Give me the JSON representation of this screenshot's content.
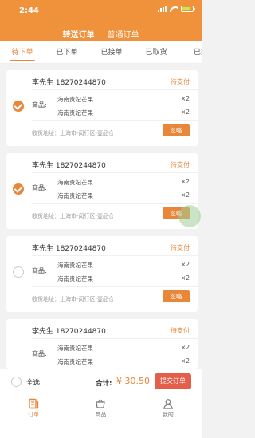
{
  "status_bar": {
    "time": "2:44"
  },
  "order_type_tabs": [
    {
      "label": "转送订单",
      "active": true
    },
    {
      "label": "普通订单",
      "active": false
    }
  ],
  "status_tabs": [
    {
      "label": "待下单",
      "active": true
    },
    {
      "label": "已下单",
      "active": false
    },
    {
      "label": "已接单",
      "active": false
    },
    {
      "label": "已取货",
      "active": false
    },
    {
      "label": "已完",
      "active": false
    }
  ],
  "orders": [
    {
      "name": "李先生 18270244870",
      "status": "待支付",
      "goods_label": "商品:",
      "items": [
        {
          "name": "海南贵妃芒果",
          "qty": "×2"
        },
        {
          "name": "海南贵妃芒果",
          "qty": "×2"
        }
      ],
      "address": "收货地址：上海市-闵行区-壹品仓",
      "ignore_label": "忽略",
      "checked": true
    },
    {
      "name": "李先生 18270244870",
      "status": "待支付",
      "goods_label": "商品:",
      "items": [
        {
          "name": "海南贵妃芒果",
          "qty": "×2"
        },
        {
          "name": "海南贵妃芒果",
          "qty": "×2"
        }
      ],
      "address": "收货地址：上海市-闵行区-壹品仓",
      "ignore_label": "忽略",
      "checked": true
    },
    {
      "name": "李先生 18270244870",
      "status": "待支付",
      "goods_label": "商品:",
      "items": [
        {
          "name": "海南贵妃芒果",
          "qty": "×2"
        },
        {
          "name": "海南贵妃芒果",
          "qty": "×2"
        }
      ],
      "address": "收货地址：上海市-闵行区-壹品仓",
      "ignore_label": "忽略",
      "checked": false
    },
    {
      "name": "李先生 18270244870",
      "status": "待支付",
      "goods_label": "商品:",
      "items": [
        {
          "name": "海南贵妃芒果",
          "qty": "×2"
        },
        {
          "name": "海南贵妃芒果",
          "qty": "×2"
        }
      ],
      "address": "",
      "ignore_label": "",
      "checked": false
    }
  ],
  "footer": {
    "select_all": "全选",
    "total_label": "合计:",
    "total_value": "¥ 30.50",
    "submit": "提交订单"
  },
  "bottom_nav": [
    {
      "label": "订单",
      "icon": "order-icon",
      "active": true
    },
    {
      "label": "商品",
      "icon": "basket-icon",
      "active": false
    },
    {
      "label": "我的",
      "icon": "person-icon",
      "active": false
    }
  ],
  "colors": {
    "brand": "#f0913b",
    "accent": "#e8863a",
    "submit": "#e35e4b"
  }
}
